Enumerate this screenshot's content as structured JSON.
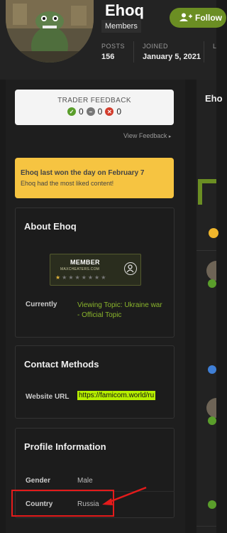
{
  "profile": {
    "username": "Ehoq",
    "group": "Members",
    "follow_label": "Follow",
    "stats": {
      "posts_label": "POSTS",
      "posts_value": "156",
      "joined_label": "JOINED",
      "joined_value": "January 5, 2021",
      "last_label": "L"
    }
  },
  "feedback": {
    "title": "TRADER FEEDBACK",
    "positive": "0",
    "neutral": "0",
    "negative": "0",
    "view_link": "View Feedback"
  },
  "award": {
    "title": "Ehoq last won the day on February 7",
    "desc": "Ehoq had the most liked content!"
  },
  "about": {
    "title": "About Ehoq",
    "rank_name": "MEMBER",
    "rank_site": "MAXCHEATERS.COM",
    "currently_label": "Currently",
    "currently_value": "Viewing Topic: Ukraine war - Official Topic"
  },
  "contact": {
    "title": "Contact Methods",
    "website_label": "Website URL",
    "website_value": "https://famicom.world/ru"
  },
  "profile_info": {
    "title": "Profile Information",
    "gender_label": "Gender",
    "gender_value": "Male",
    "country_label": "Country",
    "country_value": "Russia"
  },
  "right": {
    "title": "Eho"
  },
  "colors": {
    "accent": "#6b8e23",
    "award_bg": "#f6c441",
    "highlight": "#e41b1b",
    "url_bg": "#b7f000"
  }
}
